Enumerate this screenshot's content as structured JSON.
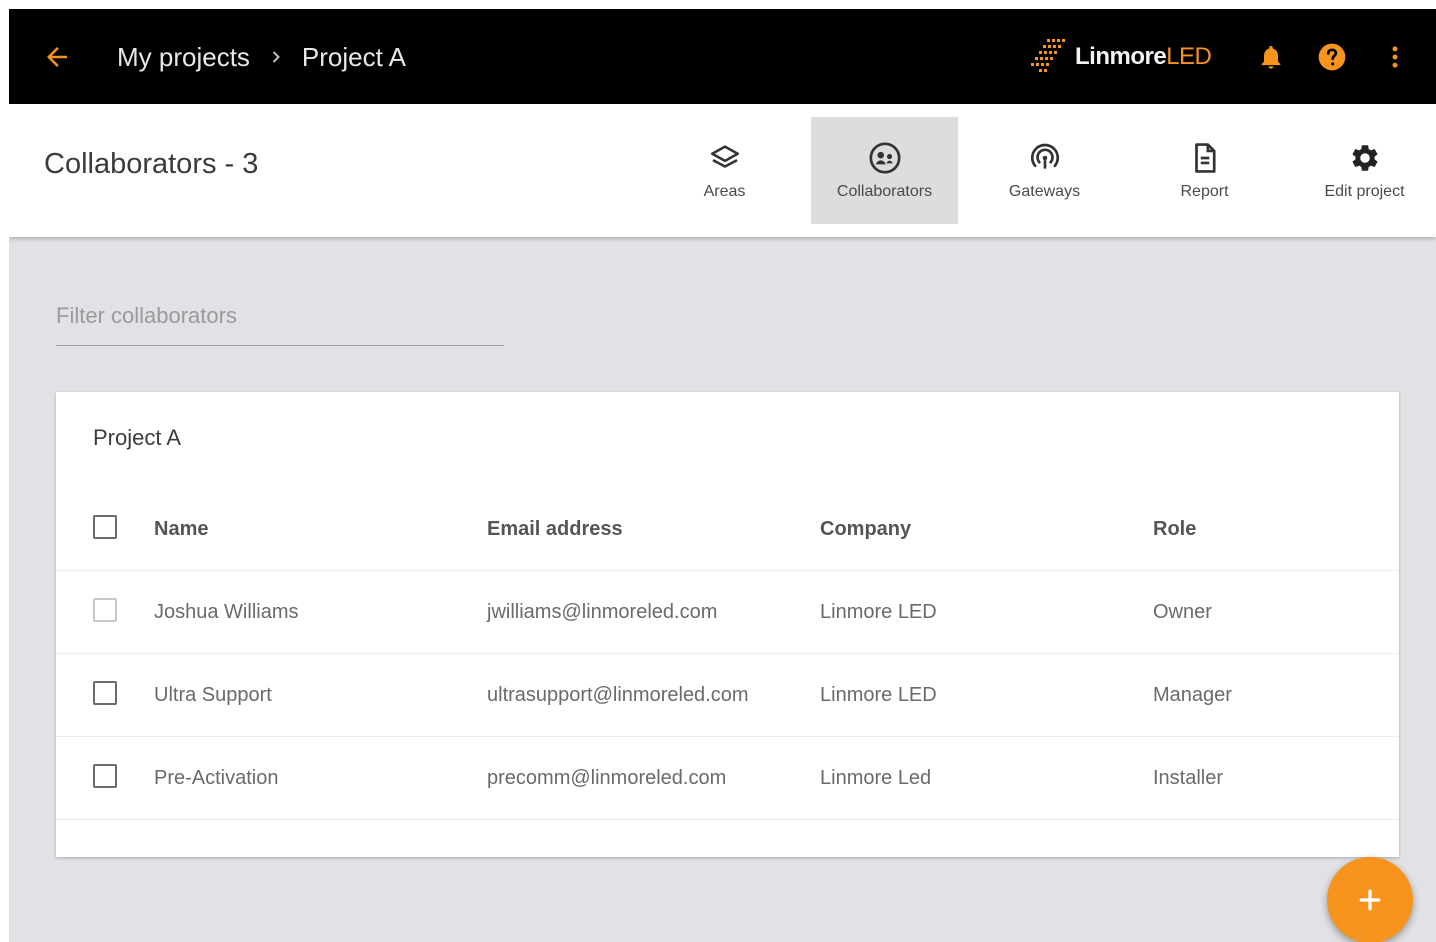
{
  "header": {
    "breadcrumb": [
      {
        "label": "My projects",
        "icon": "arrow-left-icon"
      },
      {
        "label": "Project A"
      }
    ],
    "logo": {
      "text_main": "Linmore",
      "text_accent": "LED",
      "icon": "grid-logo-icon"
    },
    "icons": [
      "bell-icon",
      "help-icon",
      "more-vert-icon"
    ],
    "accent": "#f7941d",
    "background": "#000000"
  },
  "subheader": {
    "title": "Collaborators - 3",
    "tabs": [
      {
        "label": "Areas",
        "icon": "layers-icon",
        "active": false
      },
      {
        "label": "Collaborators",
        "icon": "group-icon",
        "active": true
      },
      {
        "label": "Gateways",
        "icon": "gateway-icon",
        "active": false
      },
      {
        "label": "Report",
        "icon": "document-icon",
        "active": false
      },
      {
        "label": "Edit project",
        "icon": "gear-icon",
        "active": false
      }
    ]
  },
  "filter": {
    "placeholder": "Filter collaborators",
    "value": ""
  },
  "table": {
    "title": "Project A",
    "columns": [
      "Name",
      "Email address",
      "Company",
      "Role"
    ],
    "rows": [
      {
        "name": "Joshua Williams",
        "email": "jwilliams@linmoreled.com",
        "company": "Linmore LED",
        "role": "Owner",
        "checkbox_enabled": false
      },
      {
        "name": "Ultra Support",
        "email": "ultrasupport@linmoreled.com",
        "company": "Linmore LED",
        "role": "Manager",
        "checkbox_enabled": true
      },
      {
        "name": "Pre-Activation",
        "email": "precomm@linmoreled.com",
        "company": "Linmore Led",
        "role": "Installer",
        "checkbox_enabled": true
      }
    ]
  },
  "fab": {
    "label": "+",
    "icon": "add-icon"
  }
}
